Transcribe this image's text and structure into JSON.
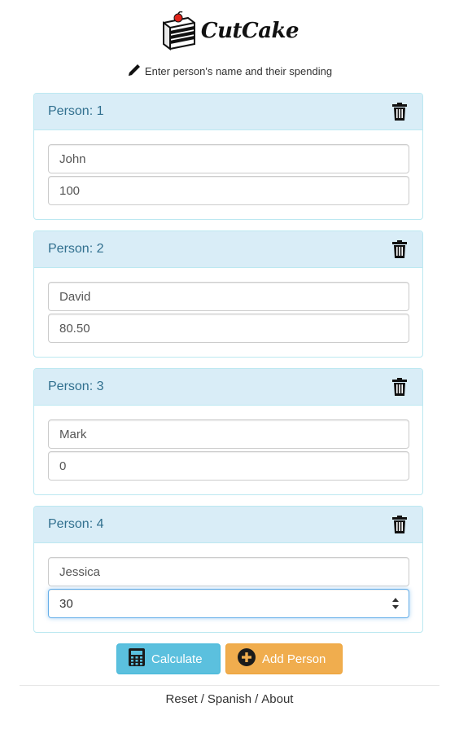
{
  "header": {
    "logo_text": "CutCake",
    "instructions": "Enter person's name and their spending"
  },
  "people": [
    {
      "title": "Person: 1",
      "name": "John",
      "amount": "100"
    },
    {
      "title": "Person: 2",
      "name": "David",
      "amount": "80.50"
    },
    {
      "title": "Person: 3",
      "name": "Mark",
      "amount": "0"
    },
    {
      "title": "Person: 4",
      "name": "Jessica",
      "amount": "30"
    }
  ],
  "actions": {
    "calculate_label": "Calculate",
    "add_person_label": "Add Person"
  },
  "footer": {
    "reset_label": "Reset",
    "spanish_label": "Spanish",
    "about_label": "About",
    "separator": "/"
  },
  "icons": {
    "logo": "cake-slice-icon",
    "instructions": "pencil-icon",
    "delete": "trash-icon",
    "calculate": "calculator-icon",
    "add": "plus-circle-icon",
    "spinner": "spinner-arrows-icon"
  },
  "colors": {
    "panel_heading_bg": "#d9edf7",
    "panel_border": "#bce8f1",
    "panel_title": "#31708f",
    "calculate_button": "#5bc0de",
    "add_person_button": "#f0ad4e",
    "focus_border": "#66afe9"
  }
}
